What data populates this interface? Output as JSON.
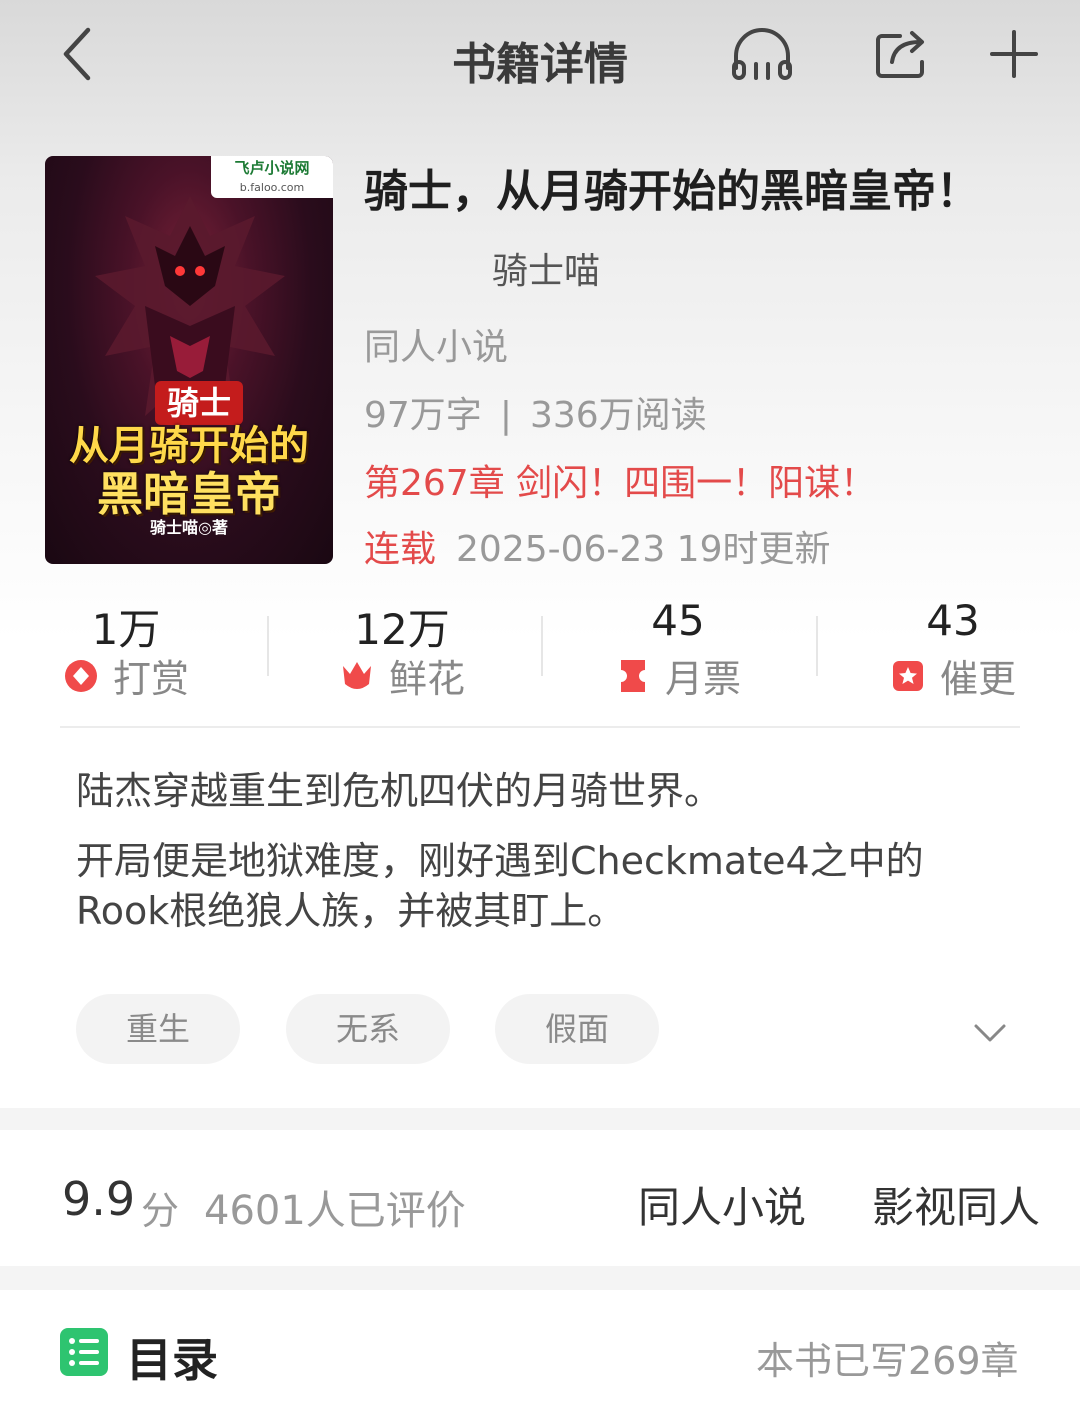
{
  "header": {
    "title": "书籍详情"
  },
  "book": {
    "title": "骑士，从月骑开始的黑暗皇帝！",
    "author": "骑士喵",
    "category": "同人小说",
    "words": "97万字",
    "stats_separator": "|",
    "reads": "336万阅读",
    "latest_chapter": "第267章 剑闪！四围一！阳谋！",
    "status": "连载",
    "update_time": "2025-06-23 19时更新",
    "cover": {
      "badge_site": "飞卢小说网",
      "badge_url": "b.faloo.com",
      "title_line1": "骑士",
      "title_line2": "从月骑开始的",
      "title_line3": "黑暗皇帝",
      "author_credit": "骑士喵◎著"
    }
  },
  "stats": [
    {
      "value": "1万",
      "label": "打赏",
      "icon": "reward-icon",
      "color": "#f04a4a"
    },
    {
      "value": "12万",
      "label": "鲜花",
      "icon": "flower-icon",
      "color": "#f04a4a"
    },
    {
      "value": "45",
      "label": "月票",
      "icon": "ticket-icon",
      "color": "#f04a4a"
    },
    {
      "value": "43",
      "label": "催更",
      "icon": "urge-icon",
      "color": "#f04a4a"
    }
  ],
  "synopsis": {
    "p1": "陆杰穿越重生到危机四伏的月骑世界。",
    "p2": "开局便是地狱难度，刚好遇到Checkmate4之中的Rook根绝狼人族，并被其盯上。"
  },
  "tags": [
    "重生",
    "无系",
    "假面"
  ],
  "rating": {
    "score": "9.9",
    "unit": "分",
    "count": "4601人已评价",
    "category_1": "同人小说",
    "category_2": "影视同人"
  },
  "toc": {
    "label": "目录",
    "chapter_count": "本书已写269章",
    "icon_color": "#2ec470"
  },
  "colors": {
    "accent_red": "#e34a4a",
    "toc_green": "#2ec470"
  }
}
